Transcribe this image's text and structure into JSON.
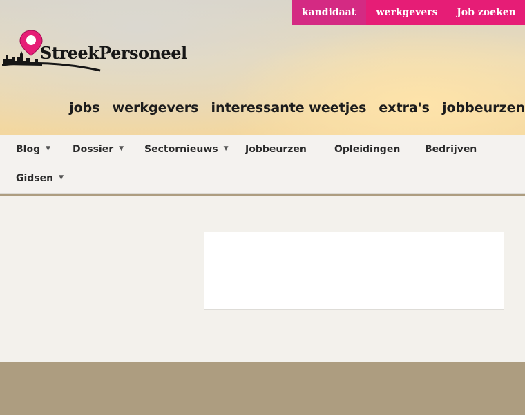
{
  "top_tabs": {
    "kandidaat": "kandidaat",
    "werkgevers": "werkgevers",
    "job_zoeken": "Job zoeken"
  },
  "logo": {
    "text": "StreekPersoneel",
    "pin_icon": "location-pin-icon"
  },
  "main_nav": [
    "jobs",
    "werkgevers",
    "interessante weetjes",
    "extra's",
    "jobbeurzen"
  ],
  "sub_nav": {
    "blog": "Blog",
    "dossier": "Dossier",
    "sectornieuws": "Sectornieuws",
    "jobbeurzen": "Jobbeurzen",
    "opleidingen": "Opleidingen",
    "bedrijven": "Bedrijven",
    "gidsen": "Gidsen",
    "chevron": "▼"
  },
  "colors": {
    "brand_pink": "#e61d76",
    "active_tab": "#d42a83",
    "footer": "#ad9d80"
  }
}
